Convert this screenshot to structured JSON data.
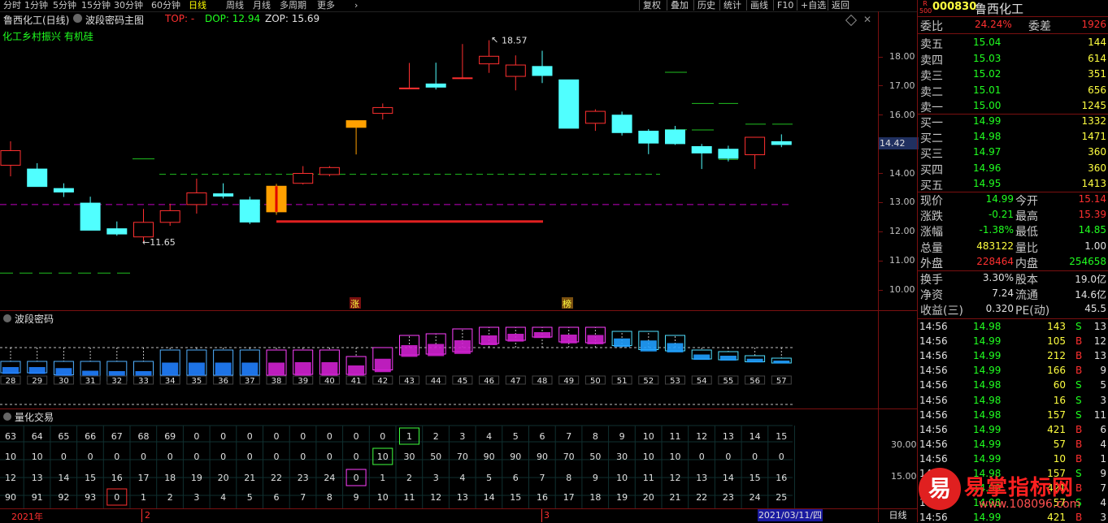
{
  "periods": [
    "分时",
    "1分钟",
    "5分钟",
    "15分钟",
    "30分钟",
    "60分钟",
    "日线",
    "周线",
    "月线",
    "多周期",
    "更多"
  ],
  "active_period": "日线",
  "tools": [
    "复权",
    "叠加",
    "历史",
    "统计",
    "画线",
    "F10",
    "+自选",
    "返回"
  ],
  "main": {
    "title": "鲁西化工(日线)",
    "indicator": "波段密码主图",
    "top": "TOP: -",
    "dop": "DOP: 12.94",
    "zop": "ZOP: 15.69",
    "concept": "化工乡村振兴 有机硅",
    "high_label": "18.57",
    "low_label": "11.65",
    "price_marker": "14.42",
    "badge_zhang": "涨",
    "badge_bang": "榜"
  },
  "sub1_title": "波段密码",
  "sub2_title": "量化交易",
  "y_ticks": [
    "18.00",
    "17.00",
    "16.00",
    "15.00",
    "14.00",
    "13.00",
    "12.00",
    "11.00",
    "10.00"
  ],
  "sub2_ticks": [
    "30.00",
    "15.00"
  ],
  "dates": {
    "year": "2021年",
    "m2": "2",
    "m3": "3",
    "cursor": "2021/03/11/四"
  },
  "period_footer": "日线",
  "chart_data": {
    "type": "candlestick",
    "candles": [
      {
        "o": 14.28,
        "h": 15.1,
        "l": 13.9,
        "c": 14.78
      },
      {
        "o": 14.15,
        "h": 14.35,
        "l": 13.62,
        "c": 13.55
      },
      {
        "o": 13.48,
        "h": 13.66,
        "l": 13.19,
        "c": 13.36
      },
      {
        "o": 12.98,
        "h": 13.2,
        "l": 12.08,
        "c": 12.05
      },
      {
        "o": 12.1,
        "h": 12.35,
        "l": 11.86,
        "c": 11.92
      },
      {
        "o": 11.82,
        "h": 12.78,
        "l": 11.65,
        "c": 12.32
      },
      {
        "o": 12.32,
        "h": 12.96,
        "l": 12.2,
        "c": 12.72
      },
      {
        "o": 12.93,
        "h": 13.82,
        "l": 12.62,
        "c": 13.33
      },
      {
        "o": 13.3,
        "h": 13.66,
        "l": 13.14,
        "c": 13.22
      },
      {
        "o": 13.09,
        "h": 13.2,
        "l": 12.26,
        "c": 12.33
      },
      {
        "o": 12.68,
        "h": 13.64,
        "l": 12.58,
        "c": 13.56
      },
      {
        "o": 13.66,
        "h": 14.25,
        "l": 13.62,
        "c": 14.0
      },
      {
        "o": 13.96,
        "h": 14.25,
        "l": 13.9,
        "c": 14.2
      },
      {
        "o": 15.58,
        "h": 15.81,
        "l": 14.65,
        "c": 15.81
      },
      {
        "o": 16.06,
        "h": 16.4,
        "l": 15.85,
        "c": 16.26
      },
      {
        "o": 16.91,
        "h": 17.79,
        "l": 16.91,
        "c": 16.93
      },
      {
        "o": 17.07,
        "h": 17.8,
        "l": 16.88,
        "c": 16.96
      },
      {
        "o": 17.28,
        "h": 18.44,
        "l": 17.24,
        "c": 17.28
      },
      {
        "o": 17.76,
        "h": 18.57,
        "l": 17.45,
        "c": 18.02
      },
      {
        "o": 17.33,
        "h": 18.05,
        "l": 16.85,
        "c": 17.72
      },
      {
        "o": 17.67,
        "h": 18.21,
        "l": 17.1,
        "c": 17.36
      },
      {
        "o": 17.21,
        "h": 17.22,
        "l": 15.55,
        "c": 15.55
      },
      {
        "o": 15.72,
        "h": 16.2,
        "l": 15.46,
        "c": 16.13
      },
      {
        "o": 16.0,
        "h": 16.12,
        "l": 15.3,
        "c": 15.4
      },
      {
        "o": 15.45,
        "h": 15.52,
        "l": 14.66,
        "c": 15.04
      },
      {
        "o": 15.49,
        "h": 15.63,
        "l": 14.98,
        "c": 15.02
      },
      {
        "o": 14.92,
        "h": 15.01,
        "l": 14.15,
        "c": 14.7
      },
      {
        "o": 14.83,
        "h": 14.95,
        "l": 14.41,
        "c": 14.52
      },
      {
        "o": 14.64,
        "h": 15.24,
        "l": 14.15,
        "c": 15.24
      },
      {
        "o": 15.09,
        "h": 15.34,
        "l": 14.9,
        "c": 14.99
      }
    ],
    "highlight_candles": [
      10,
      13
    ]
  },
  "sub1_counts": [
    "28",
    "29",
    "30",
    "31",
    "32",
    "33",
    "34",
    "35",
    "36",
    "37",
    "38",
    "39",
    "40",
    "41",
    "42",
    "43",
    "44",
    "45",
    "46",
    "47",
    "48",
    "49",
    "50",
    "51",
    "52",
    "53",
    "54",
    "55",
    "56",
    "57"
  ],
  "sub2_rows": [
    [
      "63",
      "64",
      "65",
      "66",
      "67",
      "68",
      "69",
      "0",
      "0",
      "0",
      "0",
      "0",
      "0",
      "0",
      "0",
      "1",
      "2",
      "3",
      "4",
      "5",
      "6",
      "7",
      "8",
      "9",
      "10",
      "11",
      "12",
      "13",
      "14",
      "15"
    ],
    [
      "10",
      "10",
      "0",
      "0",
      "0",
      "0",
      "0",
      "0",
      "0",
      "0",
      "0",
      "0",
      "0",
      "0",
      "10",
      "30",
      "50",
      "70",
      "90",
      "90",
      "90",
      "70",
      "50",
      "30",
      "10",
      "10",
      "0",
      "0",
      "0",
      "0"
    ],
    [
      "12",
      "13",
      "14",
      "15",
      "16",
      "17",
      "18",
      "19",
      "20",
      "21",
      "22",
      "23",
      "24",
      "0",
      "1",
      "2",
      "3",
      "4",
      "5",
      "6",
      "7",
      "8",
      "9",
      "10",
      "11",
      "12",
      "13",
      "14",
      "15",
      "16"
    ],
    [
      "90",
      "91",
      "92",
      "93",
      "0",
      "1",
      "2",
      "3",
      "4",
      "5",
      "6",
      "7",
      "8",
      "9",
      "10",
      "11",
      "12",
      "13",
      "14",
      "15",
      "16",
      "17",
      "18",
      "19",
      "20",
      "21",
      "22",
      "23",
      "24",
      "25"
    ]
  ],
  "quote": {
    "badge": "R 500",
    "code": "000830",
    "name": "鲁西化工",
    "weibi_label": "委比",
    "weibi": "24.24%",
    "weicha_label": "委差",
    "weicha": "1926",
    "sells": [
      {
        "label": "卖五",
        "price": "15.04",
        "vol": "144"
      },
      {
        "label": "卖四",
        "price": "15.03",
        "vol": "614"
      },
      {
        "label": "卖三",
        "price": "15.02",
        "vol": "351"
      },
      {
        "label": "卖二",
        "price": "15.01",
        "vol": "656"
      },
      {
        "label": "卖一",
        "price": "15.00",
        "vol": "1245"
      }
    ],
    "buys": [
      {
        "label": "买一",
        "price": "14.99",
        "vol": "1332"
      },
      {
        "label": "买二",
        "price": "14.98",
        "vol": "1471"
      },
      {
        "label": "买三",
        "price": "14.97",
        "vol": "360"
      },
      {
        "label": "买四",
        "price": "14.96",
        "vol": "360"
      },
      {
        "label": "买五",
        "price": "14.95",
        "vol": "1413"
      }
    ],
    "stats": [
      {
        "l1": "现价",
        "v1": "14.99",
        "c1": "grn",
        "l2": "今开",
        "v2": "15.14",
        "c2": "red"
      },
      {
        "l1": "涨跌",
        "v1": "-0.21",
        "c1": "grn",
        "l2": "最高",
        "v2": "15.39",
        "c2": "red"
      },
      {
        "l1": "涨幅",
        "v1": "-1.38%",
        "c1": "grn",
        "l2": "最低",
        "v2": "14.85",
        "c2": "grn"
      },
      {
        "l1": "总量",
        "v1": "483122",
        "c1": "yel",
        "l2": "量比",
        "v2": "1.00",
        "c2": "wht"
      },
      {
        "l1": "外盘",
        "v1": "228464",
        "c1": "red",
        "l2": "内盘",
        "v2": "254658",
        "c2": "grn"
      }
    ],
    "stats2": [
      {
        "l1": "换手",
        "v1": "3.30%",
        "l2": "股本",
        "v2": "19.0亿"
      },
      {
        "l1": "净资",
        "v1": "7.24",
        "l2": "流通",
        "v2": "14.6亿"
      },
      {
        "l1": "收益(三)",
        "v1": "0.320",
        "l2": "PE(动)",
        "v2": "45.5"
      }
    ],
    "ticks": [
      {
        "t": "14:56",
        "p": "14.98",
        "v": "143",
        "s": "S",
        "n": "13"
      },
      {
        "t": "14:56",
        "p": "14.99",
        "v": "105",
        "s": "B",
        "n": "12"
      },
      {
        "t": "14:56",
        "p": "14.99",
        "v": "212",
        "s": "B",
        "n": "13"
      },
      {
        "t": "14:56",
        "p": "14.99",
        "v": "166",
        "s": "B",
        "n": "9"
      },
      {
        "t": "14:56",
        "p": "14.98",
        "v": "60",
        "s": "S",
        "n": "5"
      },
      {
        "t": "14:56",
        "p": "14.98",
        "v": "16",
        "s": "S",
        "n": "3"
      },
      {
        "t": "14:56",
        "p": "14.98",
        "v": "157",
        "s": "S",
        "n": "11"
      },
      {
        "t": "14:56",
        "p": "14.99",
        "v": "421",
        "s": "B",
        "n": "6"
      },
      {
        "t": "14:56",
        "p": "14.99",
        "v": "57",
        "s": "B",
        "n": "4"
      },
      {
        "t": "14:56",
        "p": "14.99",
        "v": "10",
        "s": "B",
        "n": "1"
      },
      {
        "t": "14:56",
        "p": "14.98",
        "v": "157",
        "s": "S",
        "n": "9"
      },
      {
        "t": "14:56",
        "p": "14.99",
        "v": "421",
        "s": "B",
        "n": "7"
      },
      {
        "t": "14:56",
        "p": "14.98",
        "v": "57",
        "s": "S",
        "n": "4"
      },
      {
        "t": "14:56",
        "p": "14.99",
        "v": "421",
        "s": "B",
        "n": "3"
      }
    ]
  },
  "watermark": {
    "logo": "易",
    "name": "易掌指标网",
    "url": "www.108096.com"
  }
}
